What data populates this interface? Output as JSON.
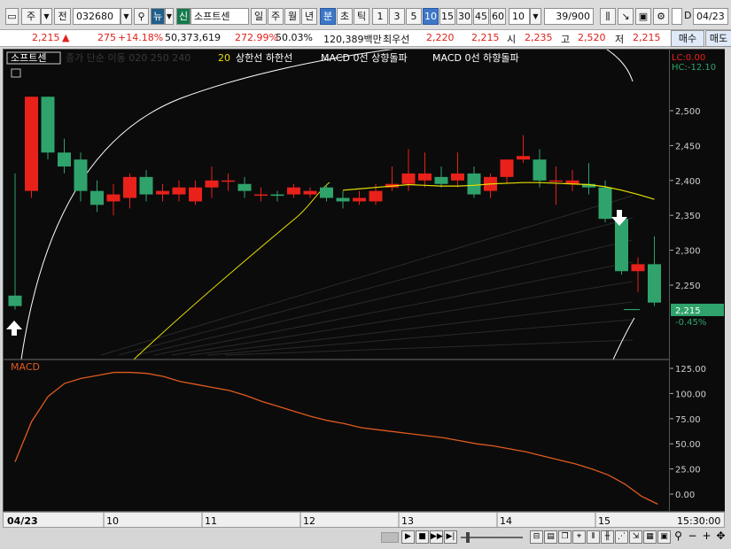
{
  "toolbar": {
    "period_type": "주",
    "prev_label": "전",
    "code": "032680",
    "new_badge": "뉴",
    "credit_badge": "신",
    "stock_name": "소프트센",
    "periods": [
      "일",
      "주",
      "월",
      "년",
      "분",
      "초",
      "틱"
    ],
    "active_period": "분",
    "minutes": [
      "1",
      "3",
      "5",
      "10",
      "15",
      "30",
      "45",
      "60"
    ],
    "active_minute": "10",
    "count_value": "10",
    "range_value": "39/900",
    "check_label": "D",
    "date_value": "04/23"
  },
  "quote": {
    "price": "2,215",
    "arrow": "▲",
    "change": "275",
    "change_pct": "+14.18%",
    "volume": "50,373,619",
    "vol_ratio": "272.99%",
    "turnover": "50.03%",
    "amount": "120,389백만",
    "priority_label": "최우선",
    "ask": "2,220",
    "bid": "2,215",
    "open_label": "시",
    "open": "2,235",
    "high_label": "고",
    "high": "2,520",
    "low_label": "저",
    "low": "2,215",
    "buy_label": "매수",
    "sell_label": "매도"
  },
  "legend": {
    "stock_tag": "소프트센",
    "faded": "종가 단순 이동 020 250 240",
    "ma_label": "20",
    "upper_lower": "상한선  하한선",
    "macd_up": "MACD 0선 상향돌파",
    "macd_down": "MACD 0선 하향돌파"
  },
  "colors": {
    "up": "#e8211a",
    "down": "#2fa36b",
    "ma": "#e6e000",
    "macd": "#e05a1e",
    "bg": "#0b0b0b"
  },
  "right_axis": {
    "lc": "LC:0.00",
    "hc": "HC:-12.10",
    "current_price": "2,215",
    "current_pct": "-0.45%"
  },
  "macd_title": "MACD",
  "x_labels": [
    "04/23",
    "10",
    "11",
    "12",
    "13",
    "14",
    "15",
    "15:30:00"
  ],
  "chart_data": {
    "type": "candlestick",
    "price_ticks": [
      2250,
      2300,
      2350,
      2400,
      2450,
      2500
    ],
    "macd_ticks": [
      0,
      25,
      50,
      75,
      100,
      125
    ],
    "candles": [
      [
        2235,
        2410,
        2215,
        2220
      ],
      [
        2385,
        2520,
        2375,
        2520
      ],
      [
        2520,
        2520,
        2430,
        2440
      ],
      [
        2440,
        2460,
        2410,
        2420
      ],
      [
        2430,
        2440,
        2370,
        2385
      ],
      [
        2385,
        2400,
        2355,
        2365
      ],
      [
        2370,
        2395,
        2350,
        2380
      ],
      [
        2375,
        2410,
        2360,
        2405
      ],
      [
        2405,
        2415,
        2370,
        2380
      ],
      [
        2380,
        2395,
        2370,
        2385
      ],
      [
        2380,
        2400,
        2370,
        2390
      ],
      [
        2370,
        2400,
        2365,
        2390
      ],
      [
        2390,
        2420,
        2375,
        2400
      ],
      [
        2400,
        2410,
        2385,
        2400
      ],
      [
        2395,
        2405,
        2375,
        2385
      ],
      [
        2380,
        2390,
        2370,
        2380
      ],
      [
        2380,
        2385,
        2370,
        2378
      ],
      [
        2380,
        2395,
        2375,
        2390
      ],
      [
        2380,
        2390,
        2375,
        2385
      ],
      [
        2390,
        2395,
        2370,
        2375
      ],
      [
        2375,
        2385,
        2360,
        2370
      ],
      [
        2370,
        2385,
        2365,
        2375
      ],
      [
        2370,
        2395,
        2365,
        2385
      ],
      [
        2390,
        2420,
        2385,
        2395
      ],
      [
        2395,
        2445,
        2385,
        2410
      ],
      [
        2400,
        2440,
        2390,
        2410
      ],
      [
        2405,
        2420,
        2390,
        2395
      ],
      [
        2400,
        2440,
        2390,
        2410
      ],
      [
        2410,
        2420,
        2375,
        2380
      ],
      [
        2385,
        2410,
        2375,
        2405
      ],
      [
        2405,
        2430,
        2395,
        2430
      ],
      [
        2430,
        2465,
        2425,
        2435
      ],
      [
        2430,
        2445,
        2390,
        2400
      ],
      [
        2400,
        2420,
        2365,
        2400
      ],
      [
        2395,
        2415,
        2385,
        2400
      ],
      [
        2395,
        2425,
        2380,
        2390
      ],
      [
        2390,
        2400,
        2340,
        2345
      ],
      [
        2345,
        2350,
        2265,
        2270
      ],
      [
        2270,
        2290,
        2240,
        2280
      ],
      [
        2280,
        2320,
        2220,
        2225
      ]
    ],
    "ma20": [
      null,
      null,
      null,
      null,
      null,
      null,
      null,
      null,
      null,
      null,
      null,
      null,
      null,
      null,
      null,
      null,
      null,
      null,
      null,
      null,
      2386,
      2388,
      2390,
      2392,
      2394,
      2393,
      2392,
      2392,
      2393,
      2395,
      2396,
      2397,
      2397,
      2396,
      2395,
      2394,
      2391,
      2386,
      2380,
      2373
    ],
    "macd": [
      32,
      72,
      97,
      110,
      115,
      118,
      121,
      121,
      120,
      117,
      112,
      109,
      106,
      103,
      98,
      92,
      87,
      82,
      77,
      73,
      70,
      66,
      64,
      62,
      60,
      58,
      56,
      53,
      50,
      48,
      45,
      42,
      38,
      34,
      30,
      25,
      19,
      10,
      -2,
      -10
    ]
  }
}
